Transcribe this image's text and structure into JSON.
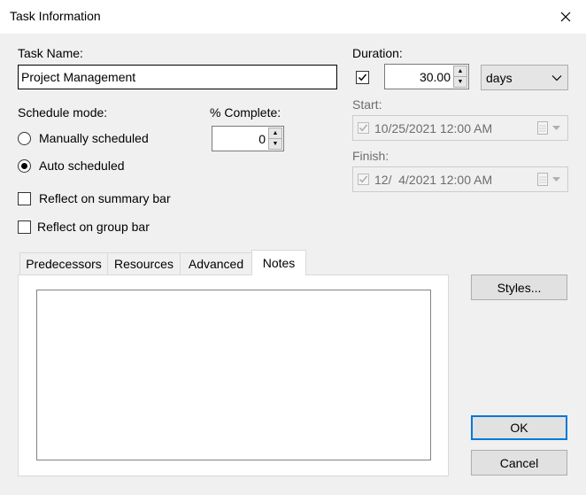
{
  "window": {
    "title": "Task Information"
  },
  "task_name": {
    "label": "Task Name:",
    "value": "Project Management"
  },
  "duration": {
    "label": "Duration:",
    "checked": true,
    "value": "30.00",
    "unit": "days"
  },
  "start": {
    "label": "Start:",
    "value": "10/25/2021 12:00 AM"
  },
  "finish": {
    "label": "Finish:",
    "value": "12/  4/2021 12:00 AM"
  },
  "schedule_mode": {
    "label": "Schedule mode:",
    "options": [
      {
        "label": "Manually scheduled",
        "selected": false
      },
      {
        "label": "Auto scheduled",
        "selected": true
      }
    ]
  },
  "percent_complete": {
    "label": "% Complete:",
    "value": "0"
  },
  "reflect_summary": {
    "label": "Reflect on summary bar",
    "checked": false
  },
  "reflect_group": {
    "label": "Reflect on group bar",
    "checked": false
  },
  "tabs": [
    {
      "label": "Predecessors",
      "active": false
    },
    {
      "label": "Resources",
      "active": false
    },
    {
      "label": "Advanced",
      "active": false
    },
    {
      "label": "Notes",
      "active": true
    }
  ],
  "notes": {
    "value": ""
  },
  "buttons": {
    "styles": "Styles...",
    "ok": "OK",
    "cancel": "Cancel"
  },
  "icons": {
    "close": "close-icon",
    "spin_up": "spin-up-icon",
    "spin_down": "spin-down-icon",
    "dropdown": "chevron-down-icon",
    "calendar": "calendar-icon",
    "check": "checkmark-icon"
  },
  "colors": {
    "dialog_bg": "#f0f0f0",
    "focus_border": "#0078d7",
    "disabled_text": "#6d6d6d"
  }
}
